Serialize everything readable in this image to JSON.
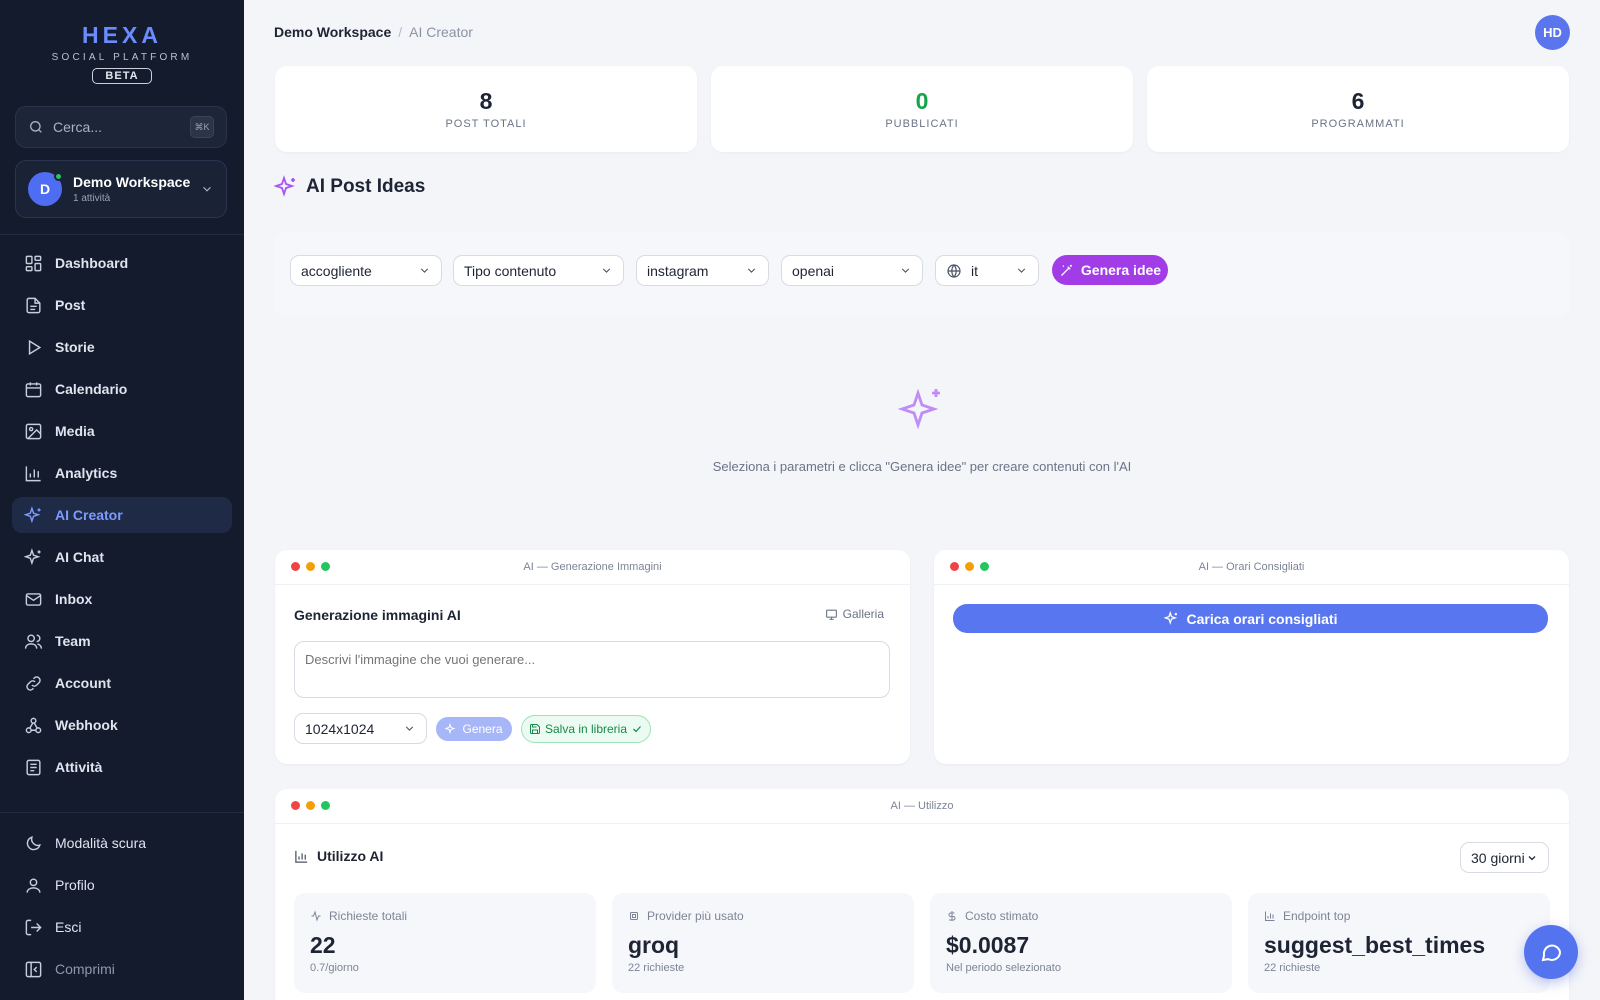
{
  "brand": {
    "name": "HEXA",
    "tagline": "SOCIAL PLATFORM",
    "badge": "BETA"
  },
  "search": {
    "placeholder": "Cerca...",
    "shortcut": "⌘K"
  },
  "workspace": {
    "name": "Demo Workspace",
    "meta": "1 attività",
    "initial": "D"
  },
  "nav": [
    {
      "label": "Dashboard",
      "icon": "grid-icon"
    },
    {
      "label": "Post",
      "icon": "document-icon"
    },
    {
      "label": "Storie",
      "icon": "play-icon"
    },
    {
      "label": "Calendario",
      "icon": "calendar-icon"
    },
    {
      "label": "Media",
      "icon": "image-icon"
    },
    {
      "label": "Analytics",
      "icon": "bar-chart-icon"
    },
    {
      "label": "AI Creator",
      "icon": "sparkles-icon",
      "active": true
    },
    {
      "label": "AI Chat",
      "icon": "sparkles-icon"
    },
    {
      "label": "Inbox",
      "icon": "mail-icon"
    },
    {
      "label": "Team",
      "icon": "users-icon"
    },
    {
      "label": "Account",
      "icon": "link-icon"
    },
    {
      "label": "Webhook",
      "icon": "webhook-icon"
    },
    {
      "label": "Attività",
      "icon": "activity-icon"
    }
  ],
  "bottom_nav": {
    "dark_mode": "Modalità scura",
    "profile": "Profilo",
    "logout": "Esci",
    "collapse": "Comprimi"
  },
  "breadcrumb": {
    "workspace": "Demo Workspace",
    "separator": "/",
    "current": "AI Creator"
  },
  "user": {
    "initials": "HD"
  },
  "stats": [
    {
      "value": "8",
      "label": "POST TOTALI",
      "color": "#1e2433"
    },
    {
      "value": "0",
      "label": "PUBBLICATI",
      "color": "#16a34a"
    },
    {
      "value": "6",
      "label": "PROGRAMMATI",
      "color": "#1e2433"
    }
  ],
  "ideas": {
    "title": "AI Post Ideas",
    "tone": "accogliente",
    "content_type": "Tipo contenuto",
    "platform": "instagram",
    "provider": "openai",
    "language": "it",
    "generate_label": "Genera idee",
    "empty_message": "Seleziona i parametri e clicca \"Genera idee\" per creare contenuti con l'AI"
  },
  "image_gen": {
    "window_title": "AI — Generazione Immagini",
    "title": "Generazione immagini AI",
    "gallery_label": "Galleria",
    "prompt_placeholder": "Descrivi l'immagine che vuoi generare...",
    "size": "1024x1024",
    "generate_label": "Genera",
    "save_label": "Salva in libreria"
  },
  "best_times": {
    "window_title": "AI — Orari Consigliati",
    "load_label": "Carica orari consigliati"
  },
  "usage": {
    "window_title": "AI — Utilizzo",
    "title": "Utilizzo AI",
    "period": "30 giorni",
    "metrics": [
      {
        "label": "Richieste totali",
        "value": "22",
        "sub": "0.7/giorno",
        "icon": "activity-icon"
      },
      {
        "label": "Provider più usato",
        "value": "groq",
        "sub": "22 richieste",
        "icon": "cpu-icon"
      },
      {
        "label": "Costo stimato",
        "value": "$0.0087",
        "sub": "Nel periodo selezionato",
        "icon": "dollar-icon"
      },
      {
        "label": "Endpoint top",
        "value": "suggest_best_times",
        "sub": "22 richieste",
        "icon": "bar-chart-icon"
      }
    ]
  },
  "colors": {
    "sidebar_bg": "#141b2d",
    "accent": "#5876ef",
    "purple": "#a13ce6",
    "success": "#16a34a"
  }
}
